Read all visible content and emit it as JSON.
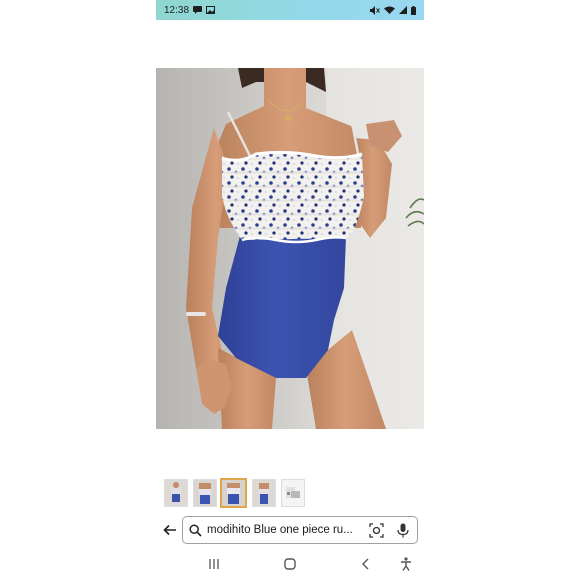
{
  "status_bar": {
    "time": "12:38",
    "left_icons": [
      "message-icon",
      "image-icon"
    ],
    "right_icons": [
      "mute-icon",
      "wifi-icon",
      "signal-icon",
      "battery-icon"
    ]
  },
  "product": {
    "main_image": "swimsuit-model-photo",
    "thumbnails": [
      {
        "name": "thumbnail-1",
        "selected": false
      },
      {
        "name": "thumbnail-2",
        "selected": false
      },
      {
        "name": "thumbnail-3",
        "selected": true
      },
      {
        "name": "thumbnail-4",
        "selected": false
      },
      {
        "name": "thumbnail-5",
        "selected": false
      }
    ]
  },
  "search": {
    "query": "modihito Blue one piece ru..."
  },
  "nav_bar": {
    "buttons": [
      "recents-icon",
      "home-icon",
      "back-nav-icon",
      "accessibility-icon"
    ]
  },
  "colors": {
    "status_bar": "#93d9ea",
    "swimsuit_blue": "#3d53b0",
    "thumbnail_selected_border": "#e2a64a"
  }
}
